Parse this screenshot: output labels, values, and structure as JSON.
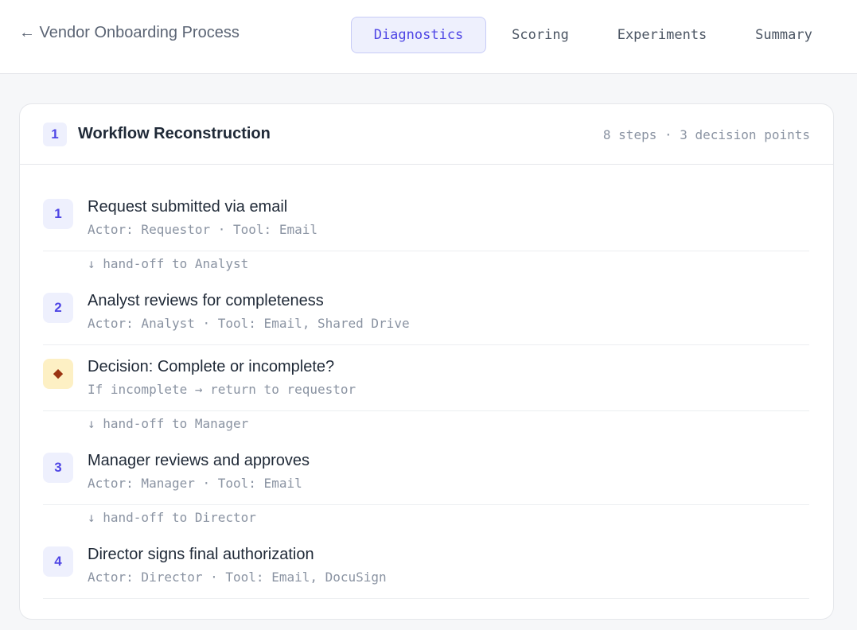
{
  "header": {
    "back_label": "← Vendor Onboarding Process",
    "tabs": [
      {
        "label": "Diagnostics",
        "active": true
      },
      {
        "label": "Scoring",
        "active": false
      },
      {
        "label": "Experiments",
        "active": false
      },
      {
        "label": "Summary",
        "active": false
      }
    ]
  },
  "section": {
    "number": "1",
    "title": "Workflow Reconstruction",
    "meta": "8 steps · 3 decision points"
  },
  "steps": [
    {
      "badge": "1",
      "title": "Request submitted via email",
      "sub": "Actor: Requestor · Tool: Email"
    },
    {
      "handoff": "↓ hand-off to Analyst"
    },
    {
      "badge": "2",
      "title": "Analyst reviews for completeness",
      "sub": "Actor: Analyst · Tool: Email, Shared Drive"
    },
    {
      "badge": "◆",
      "title": "Decision: Complete or incomplete?",
      "sub": "If incomplete → return to requestor"
    },
    {
      "handoff": "↓ hand-off to Manager"
    },
    {
      "badge": "3",
      "title": "Manager reviews and approves",
      "sub": "Actor: Manager · Tool: Email"
    },
    {
      "handoff": "↓ hand-off to Director"
    },
    {
      "badge": "4",
      "title": "Director signs final authorization",
      "sub": "Actor: Director · Tool: Email, DocuSign"
    }
  ],
  "colors": {
    "accent": "#4f46e5",
    "accent_bg": "#eef0fd",
    "decision_bg": "#fdf0c4",
    "decision_fg": "#9a3412",
    "muted": "#8a93a2"
  }
}
